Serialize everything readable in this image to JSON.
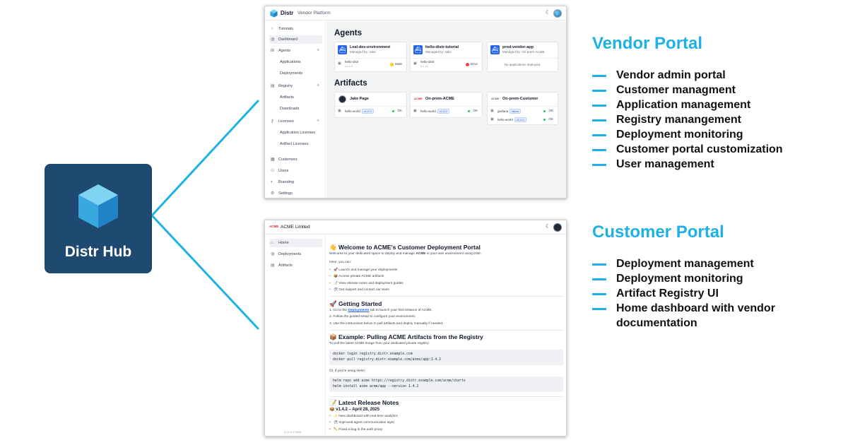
{
  "hub": {
    "label": "Distr Hub"
  },
  "colors": {
    "hub_bg": "#1e4a72",
    "accent": "#1db1e5",
    "brand_blue": "#2563eb",
    "stale": "#facc15",
    "error": "#ef4444",
    "ok": "#22c55e"
  },
  "vendor_screen": {
    "brand": "Distr",
    "subtitle": "Vendor Platform",
    "sidebar": {
      "tutorials": "Tutorials",
      "dashboard": "Dashboard",
      "agents": "Agents",
      "applications": "Applications",
      "deployments": "Deployments",
      "registry": "Registry",
      "artifacts": "Artifacts",
      "downloads": "Downloads",
      "licenses": "Licenses",
      "application_licenses": "Application Licenses",
      "artifact_licenses": "Artifact Licenses",
      "customers": "Customers",
      "users": "Users",
      "branding": "Branding",
      "settings": "Settings"
    },
    "agents_title": "Agents",
    "agents": [
      {
        "name": "Leal-dev-environment",
        "managed_by": "Managed by: Jake",
        "app": "hello-distr",
        "version": "v1.0.0",
        "status": "Stale"
      },
      {
        "name": "hello-distr-tutorial",
        "managed_by": "Managed by: Jake",
        "app": "hello-distr",
        "version": "0.1.10",
        "status": "Error"
      },
      {
        "name": "prod-vendor-app",
        "managed_by": "Managed by: On-prem-ACME",
        "empty": "No applications deployed."
      }
    ],
    "artifacts_title": "Artifacts",
    "artifacts": [
      {
        "owner": "Jake Page",
        "rows": [
          {
            "name": "hello-world",
            "tag": "v1.0.0",
            "status": "OK"
          }
        ]
      },
      {
        "owner": "On-prem-ACME",
        "logo": "ACME",
        "rows": [
          {
            "name": "hello-world",
            "tag": "v1.0.0",
            "status": "OK"
          }
        ]
      },
      {
        "owner": "On-prem-Customer",
        "logo": "ACME",
        "rows": [
          {
            "name": "grafana",
            "tag": "latest",
            "status": "OK"
          },
          {
            "name": "hello-world",
            "tag": "v1.0.0",
            "status": "OK"
          }
        ]
      }
    ]
  },
  "customer_screen": {
    "logo": "ACME",
    "brand": "ACME Limited",
    "sidebar": {
      "home": "Home",
      "deployments": "Deployments",
      "artifacts": "Artifacts"
    },
    "welcome_title": "👋 Welcome to ACME's Customer Deployment Portal",
    "welcome_pre": "Welcome to your dedicated space to deploy and manage ",
    "welcome_bold": "ACME",
    "welcome_post": " in your own environment using Distr.",
    "here_you_can": "Here, you can:",
    "bullets": [
      "🚀 Launch and manage your deployments",
      "📦 Access private ACME artifacts",
      "📝 View release notes and deployment guides",
      "🛠 Get support and contact our team"
    ],
    "getting_started_title": "🚀 Getting Started",
    "step1_pre": "1. Go to the ",
    "step1_link": "Deployments",
    "step1_post": " tab to launch your first instance of ACME.",
    "step2": "2. Follow the guided setup to configure your environment.",
    "step3": "3. Use the instructions below to pull artifacts and deploy manually if needed.",
    "example_title": "📦 Example: Pulling ACME Artifacts from the Registry",
    "example_intro": "To pull the latest ACME image from your dedicated private registry:",
    "docker_code": "docker login registry.distr.example.com\ndocker pull registry.distr.example.com/acme/app:1.4.2",
    "helm_intro": "Or, if you're using Helm:",
    "helm_code": "helm repo add acme https://registry.distr.example.com/acme/charts\nhelm install acme acme/app --version 1.4.2",
    "release_title": "📝 Latest Release Notes",
    "release_version": "📦 v1.4.2 – April 28, 2025",
    "release_items": [
      "✨ New dashboard with real-time analytics",
      "🛠 Improved agent communication layer",
      "✏️ Fixed a bug in the auth proxy"
    ],
    "version_footer": "1.11.0-0.16f4f"
  },
  "vendor_portal": {
    "title": "Vendor Portal",
    "features": [
      "Vendor admin portal",
      "Customer managment",
      "Application management",
      "Registry manangement",
      "Deployment monitoring",
      "Customer portal customization",
      "User management"
    ]
  },
  "customer_portal": {
    "title": "Customer Portal",
    "features": [
      "Deployment management",
      "Deployment monitoring",
      "Artifact Registry UI",
      "Home dashboard with vendor",
      "documentation"
    ]
  }
}
